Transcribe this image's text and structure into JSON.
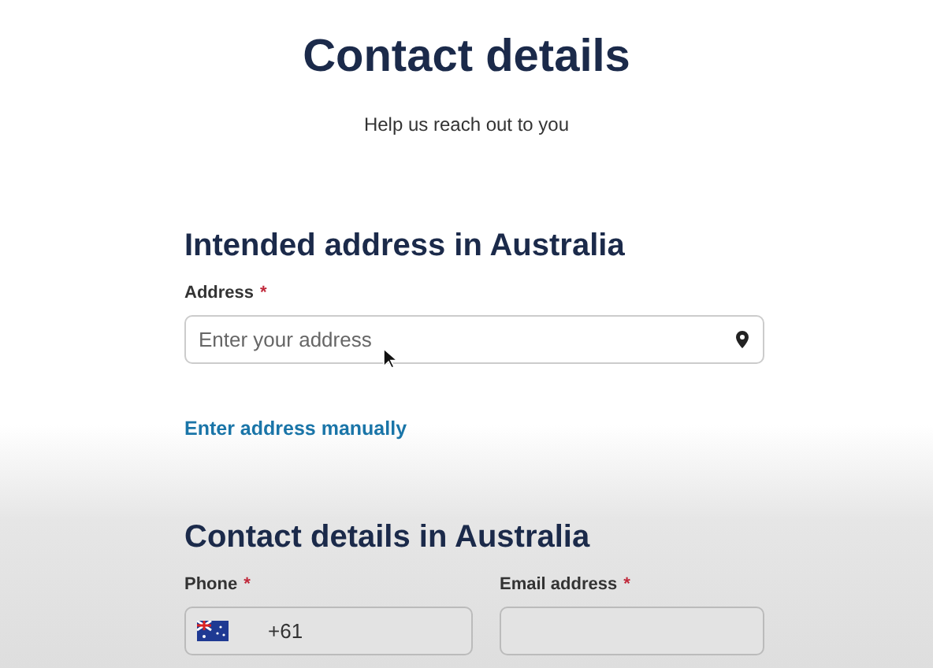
{
  "header": {
    "title": "Contact details",
    "subtitle": "Help us reach out to you"
  },
  "address_section": {
    "heading": "Intended address in Australia",
    "address_field": {
      "label": "Address",
      "required_mark": "*",
      "placeholder": "Enter your address"
    },
    "manual_link": "Enter address manually"
  },
  "contact_section": {
    "heading": "Contact details in Australia",
    "phone_field": {
      "label": "Phone",
      "required_mark": "*",
      "value": "+61"
    },
    "email_field": {
      "label": "Email address",
      "required_mark": "*"
    }
  }
}
